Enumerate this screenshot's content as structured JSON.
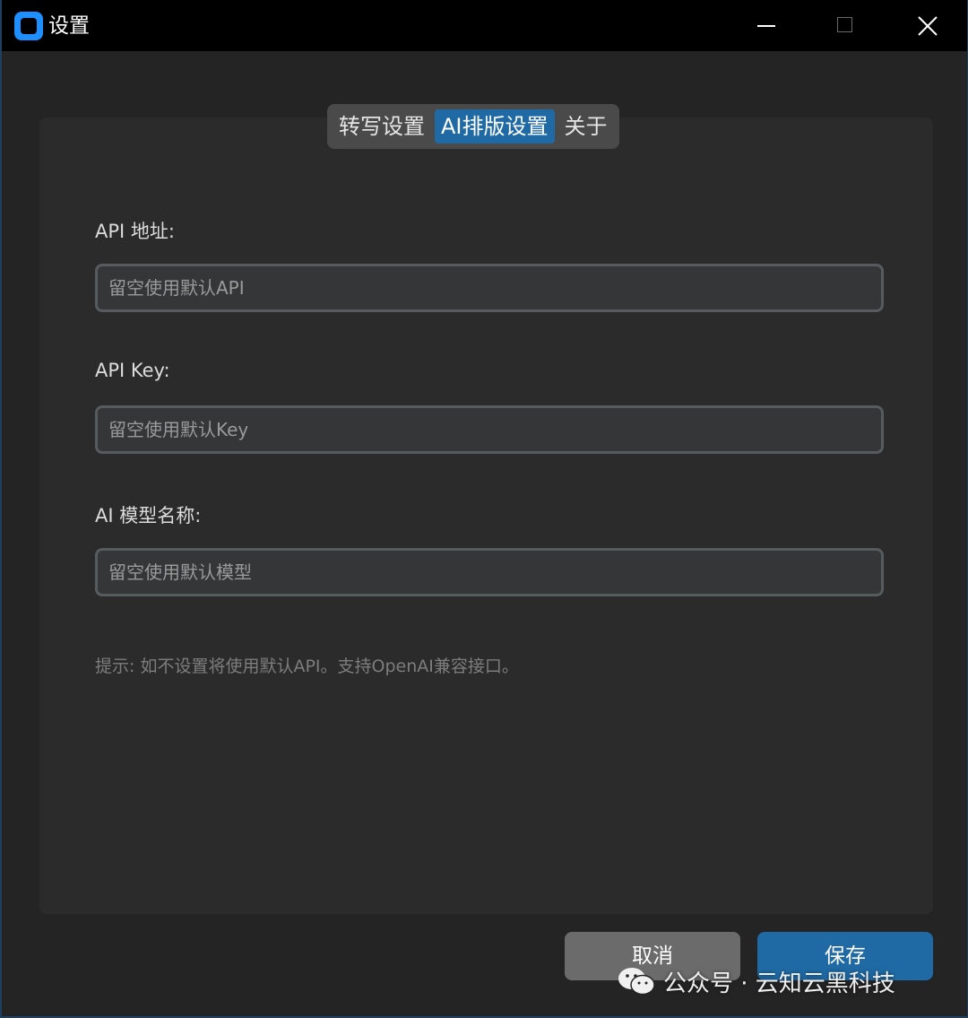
{
  "window": {
    "title": "设置",
    "accent_color": "#1f6aa5",
    "icon": "app-logo-icon"
  },
  "tabs": [
    {
      "label": "转写设置",
      "active": false
    },
    {
      "label": "AI排版设置",
      "active": true
    },
    {
      "label": "关于",
      "active": false
    }
  ],
  "form": {
    "api_url": {
      "label": "API 地址:",
      "value": "",
      "placeholder": "留空使用默认API"
    },
    "api_key": {
      "label": "API Key:",
      "value": "",
      "placeholder": "留空使用默认Key"
    },
    "model_name": {
      "label": "AI 模型名称:",
      "value": "",
      "placeholder": "留空使用默认模型"
    },
    "hint": "提示: 如不设置将使用默认API。支持OpenAI兼容接口。"
  },
  "buttons": {
    "cancel_label": "取消",
    "save_label": "保存"
  },
  "watermark": {
    "text": "公众号 · 云知云黑科技",
    "icon": "wechat-icon"
  }
}
